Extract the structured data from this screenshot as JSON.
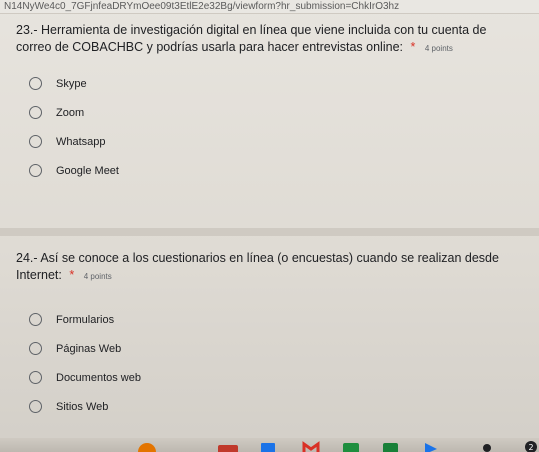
{
  "browser": {
    "url_fragment": "N14NyWe4c0_7GFjnfeaDRYmOee09t3EtlE2e32Bg/viewform?hr_submission=ChkIrO3hz"
  },
  "questions": [
    {
      "title": "23.- Herramienta de investigación digital en línea que viene incluida con tu cuenta de correo de COBACHBC y podrías usarla para hacer entrevistas online:",
      "required_mark": "*",
      "points": "4 points",
      "options": [
        "Skype",
        "Zoom",
        "Whatsapp",
        "Google Meet"
      ]
    },
    {
      "title": "24.- Así se conoce a los cuestionarios en línea (o encuestas) cuando se realizan desde Internet:",
      "required_mark": "*",
      "points": "4 points",
      "options": [
        "Formularios",
        "Páginas Web",
        "Documentos web",
        "Sitios Web"
      ]
    }
  ],
  "taskbar": {
    "badge_count": "2",
    "colors": {
      "chrome": "#e37400",
      "vpn": "#c0392b",
      "calendar": "#1a73e8",
      "gmail": "#d93025",
      "folder": "#1e8e3e",
      "meet": "#188038",
      "play": "#1a73e8",
      "badge": "#202124"
    }
  }
}
